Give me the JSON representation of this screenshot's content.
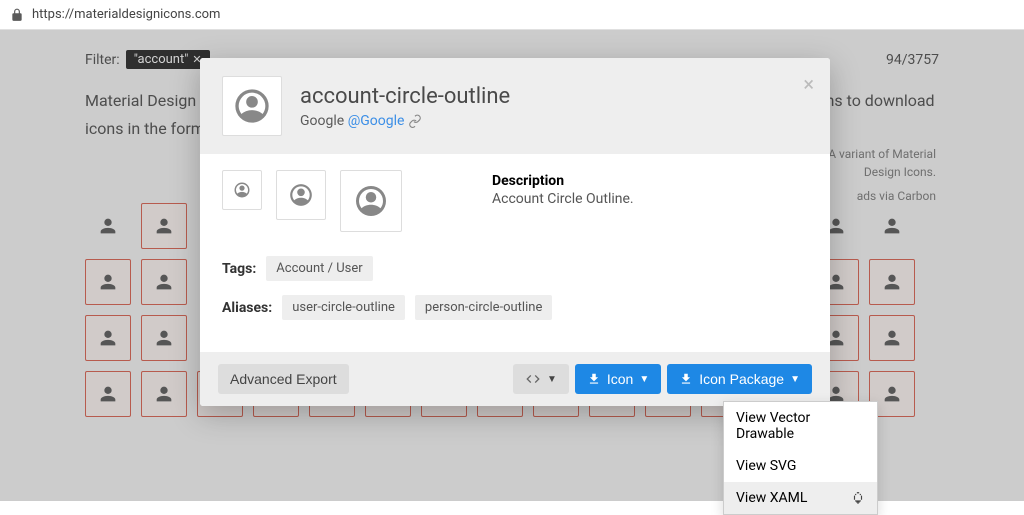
{
  "url": "https://materialdesignicons.com",
  "filter": {
    "label": "Filter:",
    "chip": "\"account\"",
    "count": "94/3757"
  },
  "intro": "Material Design Icons' growing icon collection allows designers and developers targeting various platforms to download icons in the format, color and size they need for any project.",
  "ad": {
    "line1": "A variant of Material",
    "line2": "Design Icons.",
    "via": "ads via Carbon"
  },
  "modal": {
    "title": "account-circle-outline",
    "author_text": "Google",
    "author_link": "@Google",
    "desc_label": "Description",
    "desc_text": "Account Circle Outline.",
    "tags_label": "Tags:",
    "tags": [
      "Account / User"
    ],
    "aliases_label": "Aliases:",
    "aliases": [
      "user-circle-outline",
      "person-circle-outline"
    ],
    "advanced": "Advanced Export",
    "icon_btn": "Icon",
    "package_btn": "Icon Package"
  },
  "menu": {
    "item1": "View Vector Drawable",
    "item2": "View SVG",
    "item3": "View XAML"
  }
}
